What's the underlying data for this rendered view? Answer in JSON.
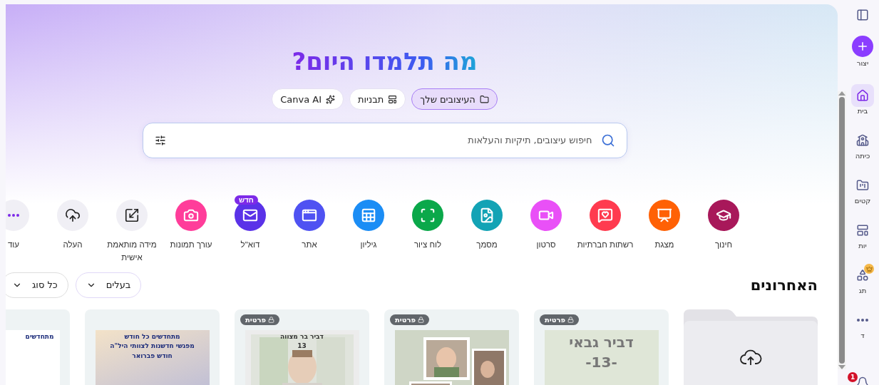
{
  "hero": {
    "title": "מה תלמדו היום?",
    "tabs": [
      {
        "label": "העיצובים שלך",
        "selected": true
      },
      {
        "label": "תבניות",
        "selected": false
      },
      {
        "label": "Canva AI",
        "selected": false
      }
    ],
    "search": {
      "placeholder": "חיפוש עיצובים, תיקיות והעלאות"
    }
  },
  "categories": [
    {
      "label": "חינוך",
      "kind": "filled",
      "color": "#a8185a"
    },
    {
      "label": "מצגת",
      "kind": "filled",
      "color": "#ff6105"
    },
    {
      "label": "רשתות חברתיות",
      "kind": "filled",
      "color": "#ff3b4f"
    },
    {
      "label": "סרטון",
      "kind": "filled",
      "color": "#e950f7"
    },
    {
      "label": "מסמך",
      "kind": "filled",
      "color": "#13a3b5"
    },
    {
      "label": "לוח ציור",
      "kind": "filled",
      "color": "#0ba84a"
    },
    {
      "label": "גיליון",
      "kind": "filled",
      "color": "#1b8df5"
    },
    {
      "label": "אתר",
      "kind": "filled",
      "color": "#4f52f2"
    },
    {
      "label": "דוא\"ל",
      "kind": "filled",
      "color": "#5a32e8",
      "badge": "חדש"
    },
    {
      "label": "עורך תמונות",
      "kind": "filled",
      "color": "#ff3d9a"
    },
    {
      "label": "מידה מותאמת אישית",
      "kind": "plain",
      "color": "#f0eff5"
    },
    {
      "label": "העלה",
      "kind": "plain",
      "color": "#f0eff5"
    },
    {
      "label": "עוד",
      "kind": "plain",
      "color": "#f0eff5"
    }
  ],
  "recents": {
    "title": "האחרונים",
    "filters": [
      "בעלים",
      "כל סוג"
    ],
    "cards": [
      {
        "kind": "folder"
      },
      {
        "kind": "design",
        "badge": "פרטית",
        "lines": [
          "דביר גבאי",
          "-13-"
        ]
      },
      {
        "badge": "פרטית"
      },
      {
        "badge": "פרטית",
        "lines": [
          "דביר בר מצווה",
          "13"
        ]
      },
      {
        "kind": "design",
        "lines": [
          "מתחדשים כל חודש",
          "מפגשי חדשנות לצוותי היל\"ה",
          "חודש פברואר"
        ]
      },
      {
        "kind": "design",
        "lines": [
          "מתחדשים"
        ]
      }
    ]
  },
  "sidebar": {
    "create": "יצור",
    "items": [
      {
        "label": "בית",
        "selected": true,
        "premium": false
      },
      {
        "label": "כיתה",
        "selected": false,
        "premium": false
      },
      {
        "label": "קטים",
        "selected": false,
        "premium": false
      },
      {
        "label": "יות",
        "selected": false,
        "premium": false
      },
      {
        "label": "תג",
        "selected": false,
        "premium": true
      },
      {
        "label": "ד",
        "selected": false,
        "premium": false
      }
    ],
    "notifications": "1"
  }
}
